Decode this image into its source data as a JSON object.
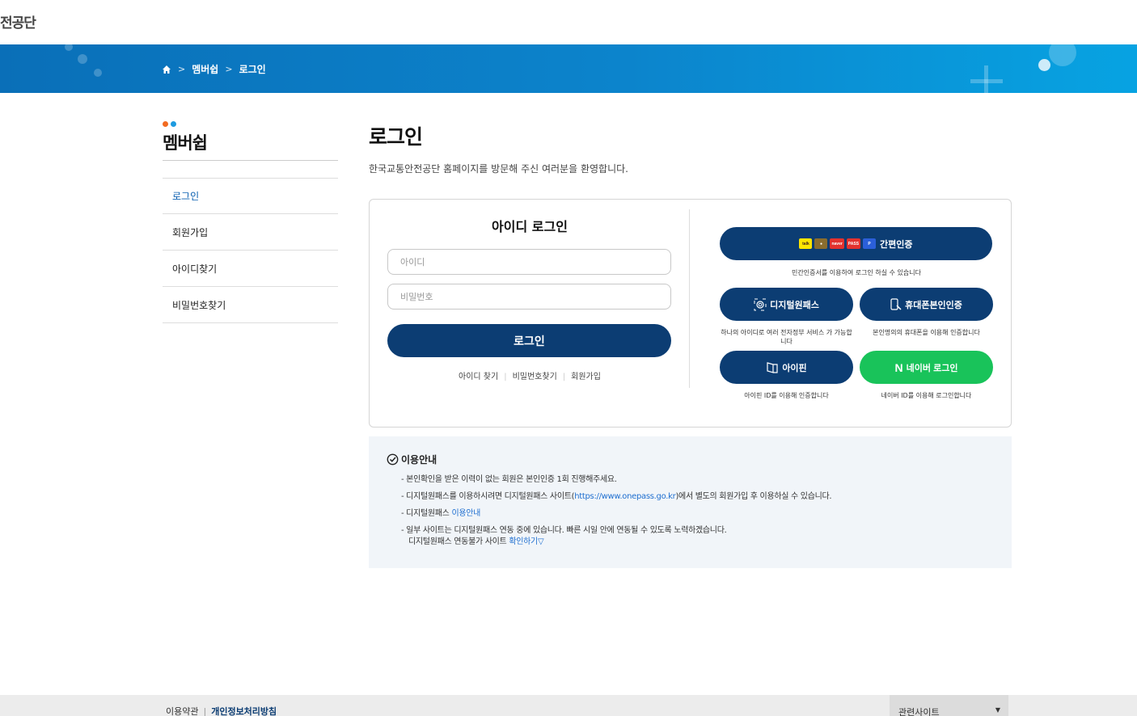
{
  "header": {
    "brand": "전공단"
  },
  "breadcrumb": {
    "items": [
      "멤버쉽",
      "로그인"
    ],
    "separator": ">"
  },
  "sidebar": {
    "title": "멤버쉽",
    "dot_colors": [
      "#f26b21",
      "#1e9be0"
    ],
    "items": [
      {
        "label": "로그인",
        "active": true
      },
      {
        "label": "회원가입",
        "active": false
      },
      {
        "label": "아이디찾기",
        "active": false
      },
      {
        "label": "비밀번호찾기",
        "active": false
      }
    ]
  },
  "main": {
    "title": "로그인",
    "welcome": "한국교통안전공단 홈페이지를 방문해 주신 여러분을 환영합니다."
  },
  "id_login": {
    "title": "아이디 로그인",
    "id_placeholder": "아이디",
    "pw_placeholder": "비밀번호",
    "login_label": "로그인",
    "links": [
      "아이디 찾기",
      "비밀번호찾기",
      "회원가입"
    ]
  },
  "cert": {
    "simple": {
      "label": "간편인증",
      "desc": "민간인증서를 이용하여 로그인 하실 수 있습니다",
      "logos": [
        "kakao",
        "toss",
        "naver",
        "pass",
        "payco"
      ]
    },
    "digital": {
      "label": "디지털원패스",
      "desc": "하나의 아이디로 여러 전자정부 서비스 가 가능합니다"
    },
    "phone": {
      "label": "휴대폰본인인증",
      "desc": "본인명의의 휴대폰을 이용해 인증합니다"
    },
    "ipin": {
      "label": "아이핀",
      "desc": "아이핀 ID를 이용해 인증합니다"
    },
    "naver": {
      "label": "네이버 로그인",
      "desc": "네이버 ID를 이용해 로그인합니다"
    }
  },
  "guide": {
    "title": "이용안내",
    "items": {
      "a": "- 본인확인을 받은 이력이 없는 회원은 본인인증 1회 진행해주세요.",
      "b_pre": "- 디지털원패스를 이용하시려면 디지털원패스 사이트(",
      "b_link": "https://www.onepass.go.kr",
      "b_post": ")에서 별도의 회원가입 후 이용하실 수 있습니다.",
      "c_pre": "- 디지털원패스 ",
      "c_link": "이용안내",
      "d_line1": "- 일부 사이트는 디지털원패스 연동 중에 있습니다. 빠른 시일 안에 연동될 수 있도록 노력하겠습니다.",
      "d_line2": "디지털원패스 연동불가 사이트 ",
      "d_link": "확인하기▽"
    }
  },
  "footer": {
    "terms": "이용약관",
    "privacy": "개인정보처리방침",
    "related": "관련사이트"
  },
  "colors": {
    "navy": "#0c3d73",
    "naver": "#19c35a",
    "banner": "#0c84cc",
    "link": "#1f6fd0"
  }
}
